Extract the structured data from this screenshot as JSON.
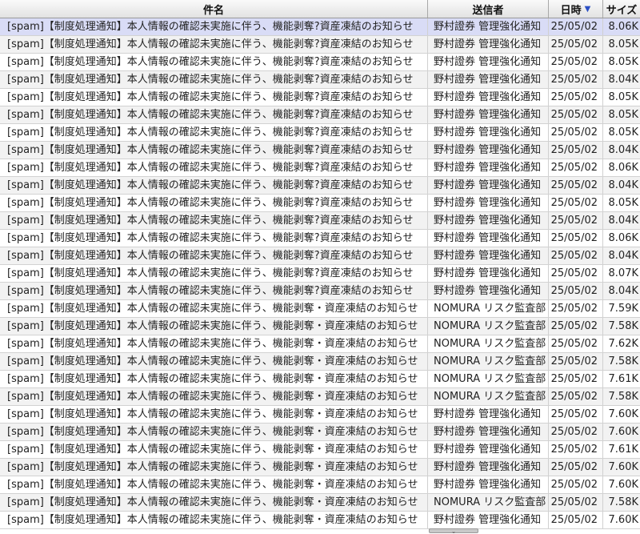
{
  "header": {
    "subject": "件名",
    "sender": "送信者",
    "date": "日時",
    "size": "サイズ",
    "sort_icon": "sort-desc-icon"
  },
  "messages": [
    {
      "subject": "[spam]【制度処理通知】本人情報の確認未実施に伴う、機能剥奪?資産凍結のお知らせ",
      "sender": "野村證券 管理強化通知",
      "date": "25/05/02",
      "size": "8.06K"
    },
    {
      "subject": "[spam]【制度処理通知】本人情報の確認未実施に伴う、機能剥奪?資産凍結のお知らせ",
      "sender": "野村證券 管理強化通知",
      "date": "25/05/02",
      "size": "8.05K"
    },
    {
      "subject": "[spam]【制度処理通知】本人情報の確認未実施に伴う、機能剥奪?資産凍結のお知らせ",
      "sender": "野村證券 管理強化通知",
      "date": "25/05/02",
      "size": "8.05K"
    },
    {
      "subject": "[spam]【制度処理通知】本人情報の確認未実施に伴う、機能剥奪?資産凍結のお知らせ",
      "sender": "野村證券 管理強化通知",
      "date": "25/05/02",
      "size": "8.04K"
    },
    {
      "subject": "[spam]【制度処理通知】本人情報の確認未実施に伴う、機能剥奪?資産凍結のお知らせ",
      "sender": "野村證券 管理強化通知",
      "date": "25/05/02",
      "size": "8.05K"
    },
    {
      "subject": "[spam]【制度処理通知】本人情報の確認未実施に伴う、機能剥奪?資産凍結のお知らせ",
      "sender": "野村證券 管理強化通知",
      "date": "25/05/02",
      "size": "8.05K"
    },
    {
      "subject": "[spam]【制度処理通知】本人情報の確認未実施に伴う、機能剥奪?資産凍結のお知らせ",
      "sender": "野村證券 管理強化通知",
      "date": "25/05/02",
      "size": "8.05K"
    },
    {
      "subject": "[spam]【制度処理通知】本人情報の確認未実施に伴う、機能剥奪?資産凍結のお知らせ",
      "sender": "野村證券 管理強化通知",
      "date": "25/05/02",
      "size": "8.04K"
    },
    {
      "subject": "[spam]【制度処理通知】本人情報の確認未実施に伴う、機能剥奪?資産凍結のお知らせ",
      "sender": "野村證券 管理強化通知",
      "date": "25/05/02",
      "size": "8.06K"
    },
    {
      "subject": "[spam]【制度処理通知】本人情報の確認未実施に伴う、機能剥奪?資産凍結のお知らせ",
      "sender": "野村證券 管理強化通知",
      "date": "25/05/02",
      "size": "8.04K"
    },
    {
      "subject": "[spam]【制度処理通知】本人情報の確認未実施に伴う、機能剥奪?資産凍結のお知らせ",
      "sender": "野村證券 管理強化通知",
      "date": "25/05/02",
      "size": "8.05K"
    },
    {
      "subject": "[spam]【制度処理通知】本人情報の確認未実施に伴う、機能剥奪?資産凍結のお知らせ",
      "sender": "野村證券 管理強化通知",
      "date": "25/05/02",
      "size": "8.04K"
    },
    {
      "subject": "[spam]【制度処理通知】本人情報の確認未実施に伴う、機能剥奪?資産凍結のお知らせ",
      "sender": "野村證券 管理強化通知",
      "date": "25/05/02",
      "size": "8.06K"
    },
    {
      "subject": "[spam]【制度処理通知】本人情報の確認未実施に伴う、機能剥奪?資産凍結のお知らせ",
      "sender": "野村證券 管理強化通知",
      "date": "25/05/02",
      "size": "8.04K"
    },
    {
      "subject": "[spam]【制度処理通知】本人情報の確認未実施に伴う、機能剥奪?資産凍結のお知らせ",
      "sender": "野村證券 管理強化通知",
      "date": "25/05/02",
      "size": "8.07K"
    },
    {
      "subject": "[spam]【制度処理通知】本人情報の確認未実施に伴う、機能剥奪?資産凍結のお知らせ",
      "sender": "野村證券 管理強化通知",
      "date": "25/05/02",
      "size": "8.04K"
    },
    {
      "subject": "[spam]【制度処理通知】本人情報の確認未実施に伴う、機能剥奪・資産凍結のお知らせ",
      "sender": "NOMURA リスク監査部",
      "date": "25/05/02",
      "size": "7.59K"
    },
    {
      "subject": "[spam]【制度処理通知】本人情報の確認未実施に伴う、機能剥奪・資産凍結のお知らせ",
      "sender": "NOMURA リスク監査部",
      "date": "25/05/02",
      "size": "7.58K"
    },
    {
      "subject": "[spam]【制度処理通知】本人情報の確認未実施に伴う、機能剥奪・資産凍結のお知らせ",
      "sender": "NOMURA リスク監査部",
      "date": "25/05/02",
      "size": "7.62K"
    },
    {
      "subject": "[spam]【制度処理通知】本人情報の確認未実施に伴う、機能剥奪・資産凍結のお知らせ",
      "sender": "NOMURA リスク監査部",
      "date": "25/05/02",
      "size": "7.58K"
    },
    {
      "subject": "[spam]【制度処理通知】本人情報の確認未実施に伴う、機能剥奪・資産凍結のお知らせ",
      "sender": "NOMURA リスク監査部",
      "date": "25/05/02",
      "size": "7.61K"
    },
    {
      "subject": "[spam]【制度処理通知】本人情報の確認未実施に伴う、機能剥奪・資産凍結のお知らせ",
      "sender": "NOMURA リスク監査部",
      "date": "25/05/02",
      "size": "7.58K"
    },
    {
      "subject": "[spam]【制度処理通知】本人情報の確認未実施に伴う、機能剥奪・資産凍結のお知らせ",
      "sender": "野村證券 管理強化通知",
      "date": "25/05/02",
      "size": "7.60K"
    },
    {
      "subject": "[spam]【制度処理通知】本人情報の確認未実施に伴う、機能剥奪・資産凍結のお知らせ",
      "sender": "野村證券 管理強化通知",
      "date": "25/05/02",
      "size": "7.60K"
    },
    {
      "subject": "[spam]【制度処理通知】本人情報の確認未実施に伴う、機能剥奪・資産凍結のお知らせ",
      "sender": "野村證券 管理強化通知",
      "date": "25/05/02",
      "size": "7.61K"
    },
    {
      "subject": "[spam]【制度処理通知】本人情報の確認未実施に伴う、機能剥奪・資産凍結のお知らせ",
      "sender": "野村證券 管理強化通知",
      "date": "25/05/02",
      "size": "7.60K"
    },
    {
      "subject": "[spam]【制度処理通知】本人情報の確認未実施に伴う、機能剥奪・資産凍結のお知らせ",
      "sender": "野村證券 管理強化通知",
      "date": "25/05/02",
      "size": "7.60K"
    },
    {
      "subject": "[spam]【制度処理通知】本人情報の確認未実施に伴う、機能剥奪・資産凍結のお知らせ",
      "sender": "NOMURA リスク監査部",
      "date": "25/05/02",
      "size": "7.58K"
    },
    {
      "subject": "[spam]【制度処理通知】本人情報の確認未実施に伴う、機能剥奪・資産凍結のお知らせ",
      "sender": "野村證券 管理強化通知",
      "date": "25/05/02",
      "size": "7.60K"
    }
  ],
  "selected_index": 0,
  "scroll": {
    "icon": "chevron-down-icon"
  }
}
